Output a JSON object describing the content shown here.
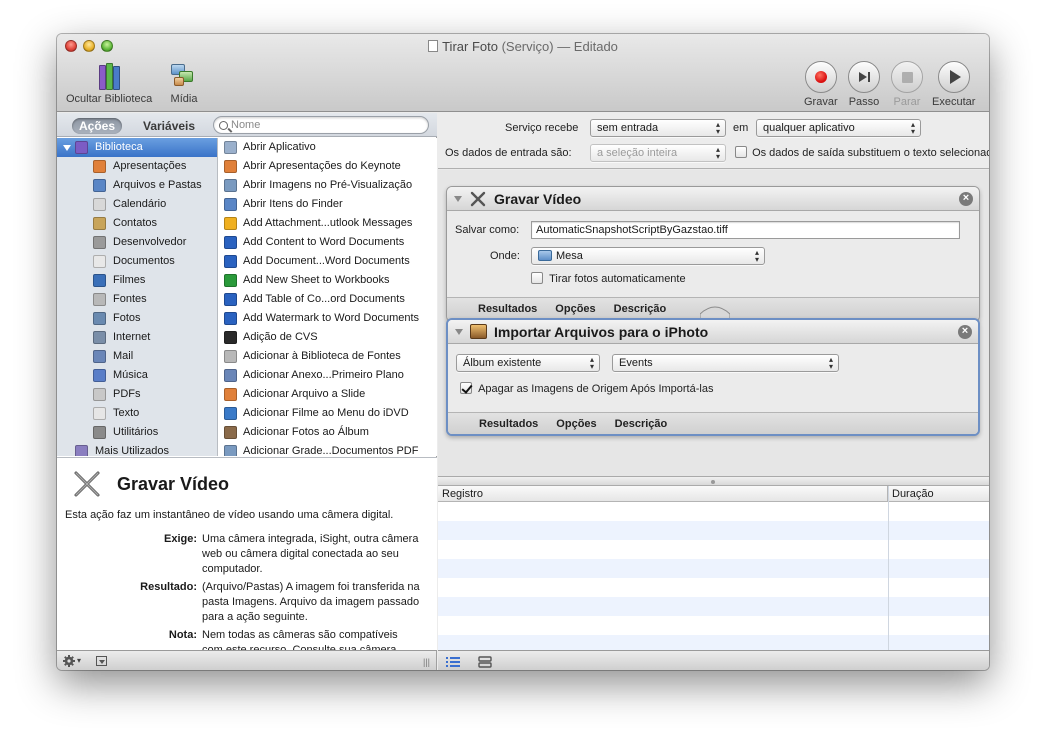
{
  "window": {
    "title": "Tirar Foto",
    "title_suffix": "(Serviço) — Editado"
  },
  "toolbar": {
    "hide_library": "Ocultar Biblioteca",
    "media": "Mídia",
    "record": "Gravar",
    "step": "Passo",
    "stop": "Parar",
    "run": "Executar"
  },
  "library": {
    "tab_actions": "Ações",
    "tab_variables": "Variáveis",
    "search_placeholder": "Nome",
    "categories": [
      {
        "label": "Biblioteca",
        "icon": "library-icon",
        "color": "#7c5cc4"
      },
      {
        "label": "Apresentações",
        "icon": "presentation-icon",
        "color": "#e0803a"
      },
      {
        "label": "Arquivos e Pastas",
        "icon": "finder-icon",
        "color": "#5a86c6"
      },
      {
        "label": "Calendário",
        "icon": "calendar-icon",
        "color": "#d8d8d8"
      },
      {
        "label": "Contatos",
        "icon": "contacts-icon",
        "color": "#c8a45a"
      },
      {
        "label": "Desenvolvedor",
        "icon": "tools-icon",
        "color": "#9a9a9a"
      },
      {
        "label": "Documentos",
        "icon": "document-icon",
        "color": "#e8e8e8"
      },
      {
        "label": "Filmes",
        "icon": "quicktime-icon",
        "color": "#3a6fb8"
      },
      {
        "label": "Fontes",
        "icon": "fonts-icon",
        "color": "#b8b8b8"
      },
      {
        "label": "Fotos",
        "icon": "photos-icon",
        "color": "#6a8ab0"
      },
      {
        "label": "Internet",
        "icon": "internet-icon",
        "color": "#7a8ea8"
      },
      {
        "label": "Mail",
        "icon": "mail-icon",
        "color": "#6a86b8"
      },
      {
        "label": "Música",
        "icon": "itunes-icon",
        "color": "#5a7ec8"
      },
      {
        "label": "PDFs",
        "icon": "pdf-icon",
        "color": "#c8c8c8"
      },
      {
        "label": "Texto",
        "icon": "text-icon",
        "color": "#e6e6e6"
      },
      {
        "label": "Utilitários",
        "icon": "utilities-icon",
        "color": "#8a8a8a"
      },
      {
        "label": "Mais Utilizados",
        "icon": "most-used-icon",
        "color": "#8a7ec0"
      }
    ],
    "actions": [
      {
        "label": "Abrir Aplicativo",
        "icon": "application-icon",
        "color": "#9ab0cc"
      },
      {
        "label": "Abrir Apresentações do Keynote",
        "icon": "keynote-icon",
        "color": "#e0803a"
      },
      {
        "label": "Abrir Imagens no Pré-Visualização",
        "icon": "preview-icon",
        "color": "#7a9ac0"
      },
      {
        "label": "Abrir Itens do Finder",
        "icon": "finder-icon",
        "color": "#5a86c6"
      },
      {
        "label": "Add Attachment...utlook Messages",
        "icon": "outlook-icon",
        "color": "#f0b020"
      },
      {
        "label": "Add Content to Word Documents",
        "icon": "word-icon",
        "color": "#2a62c0"
      },
      {
        "label": "Add Document...Word Documents",
        "icon": "word-icon",
        "color": "#2a62c0"
      },
      {
        "label": "Add New Sheet to Workbooks",
        "icon": "excel-icon",
        "color": "#2a9a3a"
      },
      {
        "label": "Add Table of Co...ord Documents",
        "icon": "word-icon",
        "color": "#2a62c0"
      },
      {
        "label": "Add Watermark to Word Documents",
        "icon": "word-icon",
        "color": "#2a62c0"
      },
      {
        "label": "Adição de CVS",
        "icon": "terminal-icon",
        "color": "#2a2a2a"
      },
      {
        "label": "Adicionar à Biblioteca de Fontes",
        "icon": "fonts-icon",
        "color": "#b8b8b8"
      },
      {
        "label": "Adicionar Anexo...Primeiro Plano",
        "icon": "mail-icon",
        "color": "#6a86b8"
      },
      {
        "label": "Adicionar Arquivo a Slide",
        "icon": "keynote-icon",
        "color": "#e0803a"
      },
      {
        "label": "Adicionar Filme ao Menu do iDVD",
        "icon": "idvd-icon",
        "color": "#3a7ac8"
      },
      {
        "label": "Adicionar Fotos ao Álbum",
        "icon": "iphoto-icon",
        "color": "#8a6a4a"
      },
      {
        "label": "Adicionar Grade...Documentos PDF",
        "icon": "preview-icon",
        "color": "#7a9ac0"
      }
    ],
    "description": {
      "title": "Gravar Vídeo",
      "summary": "Esta ação faz um instantâneo de vídeo usando uma câmera digital.",
      "requires_label": "Exige:",
      "requires": "Uma câmera integrada, iSight, outra câmera web ou câmera digital conectada ao seu computador.",
      "result_label": "Resultado:",
      "result": "(Arquivo/Pastas) A imagem foi transferida na pasta Imagens. Arquivo da imagem passado para a ação seguinte.",
      "note_label": "Nota:",
      "note": "Nem todas as câmeras são compatíveis com este recurso. Consulte sua câmera"
    }
  },
  "service": {
    "receives_label": "Serviço recebe",
    "receives_value": "sem entrada",
    "in_label": "em",
    "in_value": "qualquer aplicativo",
    "input_is_label": "Os dados de entrada são:",
    "input_is_value": "a seleção inteira",
    "replaces_label": "Os dados de saída substituem o texto selecionado"
  },
  "workflow": {
    "card1": {
      "title": "Gravar Vídeo",
      "save_as_label": "Salvar como:",
      "save_as_value": "AutomaticSnapshotScriptByGazstao.tiff",
      "where_label": "Onde:",
      "where_value": "Mesa",
      "auto_label": "Tirar fotos automaticamente",
      "auto_checked": false,
      "tab_results": "Resultados",
      "tab_options": "Opções",
      "tab_description": "Descrição"
    },
    "card2": {
      "title": "Importar Arquivos para o iPhoto",
      "album_mode": "Álbum existente",
      "album_name": "Events",
      "delete_label": "Apagar as Imagens de Origem Após Importá-las",
      "delete_checked": true,
      "tab_results": "Resultados",
      "tab_options": "Opções",
      "tab_description": "Descrição"
    }
  },
  "log": {
    "col_log": "Registro",
    "col_duration": "Duração"
  }
}
